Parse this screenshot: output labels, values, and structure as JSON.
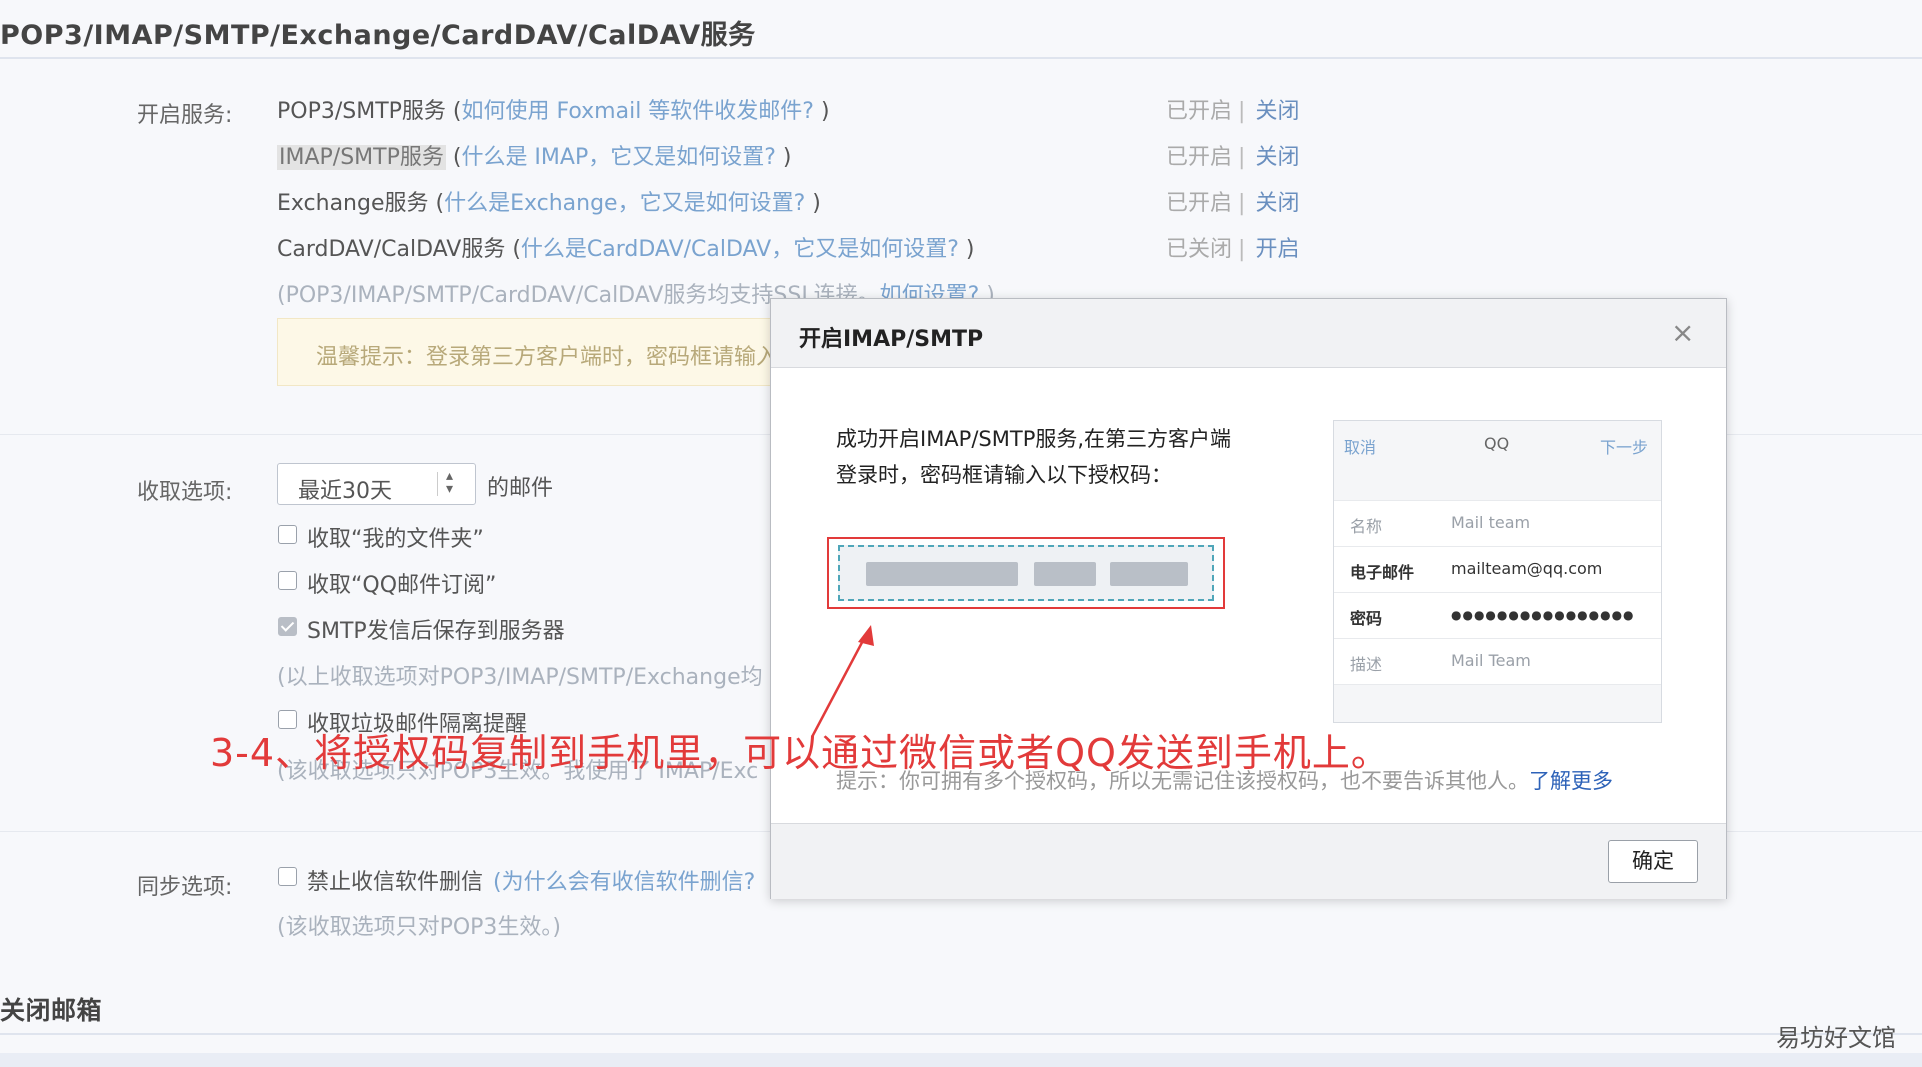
{
  "header": {
    "title": "POP3/IMAP/SMTP/Exchange/CardDAV/CalDAV服务"
  },
  "services": {
    "label": "开启服务:",
    "items": [
      {
        "name": "POP3/SMTP服务",
        "open": " (",
        "help": "如何使用 Foxmail 等软件收发邮件?",
        "close": " )",
        "state": "已开启",
        "sep": "|",
        "action": "关闭"
      },
      {
        "name": "IMAP/SMTP服务",
        "open": " (",
        "help": "什么是 IMAP，它又是如何设置?",
        "close": " )",
        "state": "已开启",
        "sep": "|",
        "action": "关闭"
      },
      {
        "name": "Exchange服务",
        "open": " (",
        "help": "什么是Exchange，它又是如何设置?",
        "close": " )",
        "state": "已开启",
        "sep": "|",
        "action": "关闭"
      },
      {
        "name": "CardDAV/CalDAV服务",
        "open": " (",
        "help": "什么是CardDAV/CalDAV，它又是如何设置?",
        "close": " )",
        "state": "已关闭",
        "sep": "|",
        "action": "开启"
      }
    ],
    "ssl_note": "(POP3/IMAP/SMTP/CardDAV/CalDAV服务均支持SSL连接。",
    "ssl_link": "如何设置?",
    "ssl_close": " )",
    "tip": "温馨提示：登录第三方客户端时，密码框请输入"
  },
  "receive": {
    "label": "收取选项:",
    "range_value": "最近30天",
    "suffix": "的邮件",
    "opt_folders": "收取“我的文件夹”",
    "opt_subscriptions": "收取“QQ邮件订阅”",
    "opt_save_sent": "SMTP发信后保存到服务器",
    "opt_note": "(以上收取选项对POP3/IMAP/SMTP/Exchange均",
    "opt_spam": "收取垃圾邮件隔离提醒",
    "opt_spam_note": "(该收取选项只对POP3生效。我使用了 IMAP/Exc"
  },
  "sync": {
    "label": "同步选项:",
    "opt_no_delete": "禁止收信软件删信",
    "opt_link": "(为什么会有收信软件删信?",
    "note": "(该收取选项只对POP3生效。)"
  },
  "close_mailbox": {
    "title": "关闭邮箱"
  },
  "modal": {
    "title": "开启IMAP/SMTP",
    "close_icon": "×",
    "line1": "成功开启IMAP/SMTP服务,在第三方客户端",
    "line2": "登录时，密码框请输入以下授权码：",
    "phone": {
      "cancel": "取消",
      "title": "QQ",
      "next": "下一步",
      "rows": [
        {
          "k": "名称",
          "v": "Mail team"
        },
        {
          "k": "电子邮件",
          "v": "mailteam@qq.com"
        },
        {
          "k": "密码",
          "v": "●●●●●●●●●●●●●●●●"
        },
        {
          "k": "描述",
          "v": "Mail Team"
        }
      ]
    },
    "hint": "提示：你可拥有多个授权码，所以无需记住该授权码，也不要告诉其他人。",
    "hint_link": "了解更多",
    "ok": "确定"
  },
  "annotation": "3-4、将授权码复制到手机里，可以通过微信或者QQ发送到手机上。",
  "watermark": "易坊好文馆",
  "colors": {
    "annotation_red": "#e23a3a",
    "link_blue": "#7aa3cf",
    "accent_blue": "#2d62b8"
  }
}
